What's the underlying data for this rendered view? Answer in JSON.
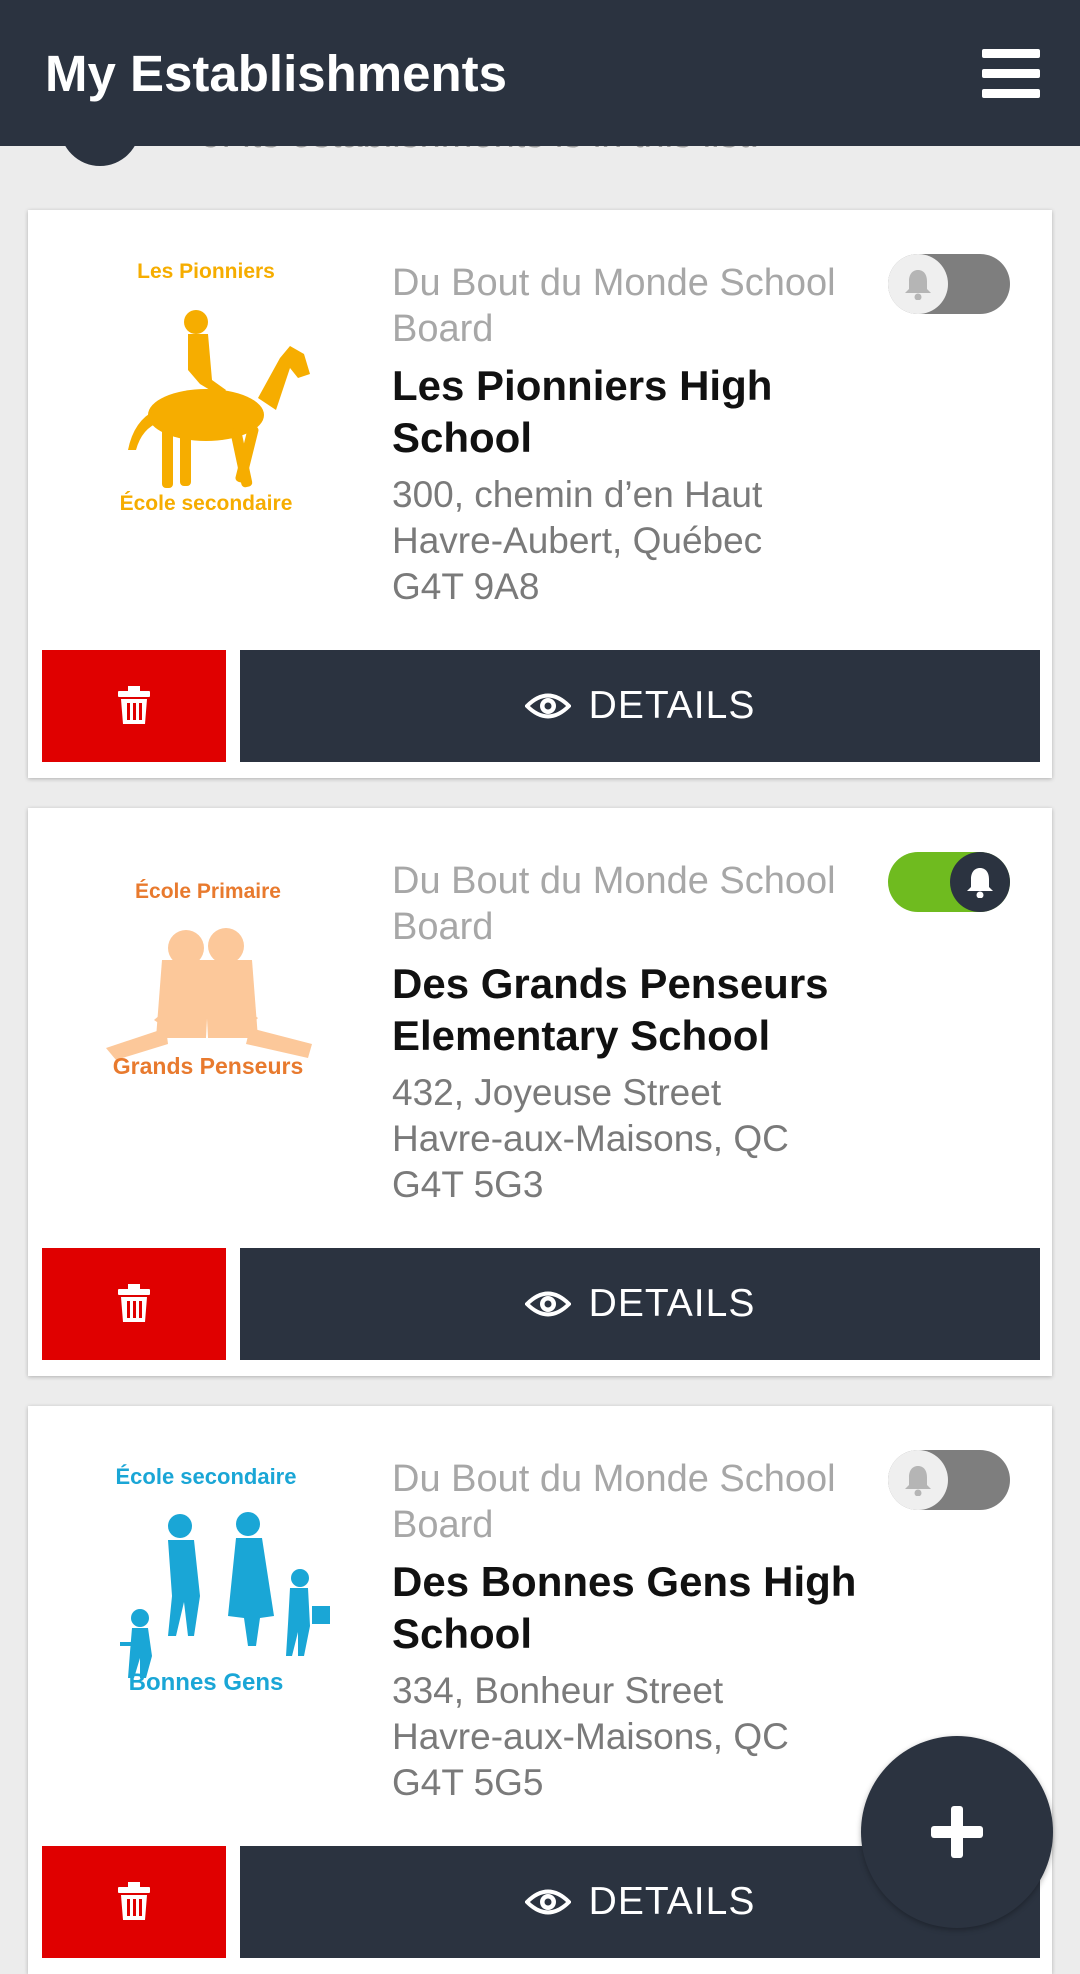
{
  "header": {
    "title": "My Establishments",
    "menu_icon": "hamburger-menu-icon"
  },
  "intro": {
    "partial_text": "of its establishments is in this list."
  },
  "establishments": [
    {
      "logo": {
        "top_text": "Les Pionniers",
        "bottom_text": "École secondaire",
        "color": "#f6ad00",
        "icon": "horse-rider-icon"
      },
      "board": "Du Bout du Monde School Board",
      "name": "Les Pionniers High School",
      "address_line1": "300, chemin d’en Haut",
      "address_line2": "Havre-Aubert, Québec",
      "postal_code": "G4T 9A8",
      "notifications_on": false,
      "details_label": "DETAILS"
    },
    {
      "logo": {
        "top_text": "École Primaire",
        "bottom_text": "Grands Penseurs",
        "top_color": "#e87a2e",
        "figure_color": "#fcc89a",
        "icon": "kids-reading-icon"
      },
      "board": "Du Bout du Monde School Board",
      "name": "Des Grands Penseurs Elementary School",
      "address_line1": "432, Joyeuse Street",
      "address_line2": "Havre-aux-Maisons, QC",
      "postal_code": "G4T 5G3",
      "notifications_on": true,
      "details_label": "DETAILS"
    },
    {
      "logo": {
        "top_text": "École secondaire",
        "bottom_text": "Bonnes Gens",
        "color": "#1aa6d6",
        "icon": "family-icon"
      },
      "board": "Du Bout du Monde School Board",
      "name": "Des Bonnes Gens High School",
      "address_line1": "334, Bonheur Street",
      "address_line2": "Havre-aux-Maisons, QC",
      "postal_code": "G4T 5G5",
      "notifications_on": false,
      "details_label": "DETAILS"
    }
  ],
  "colors": {
    "header": "#2b3340",
    "delete": "#e00000",
    "toggle_on": "#6fbb1f",
    "toggle_off": "#7e7e7e"
  },
  "fab": {
    "icon": "plus-icon"
  }
}
